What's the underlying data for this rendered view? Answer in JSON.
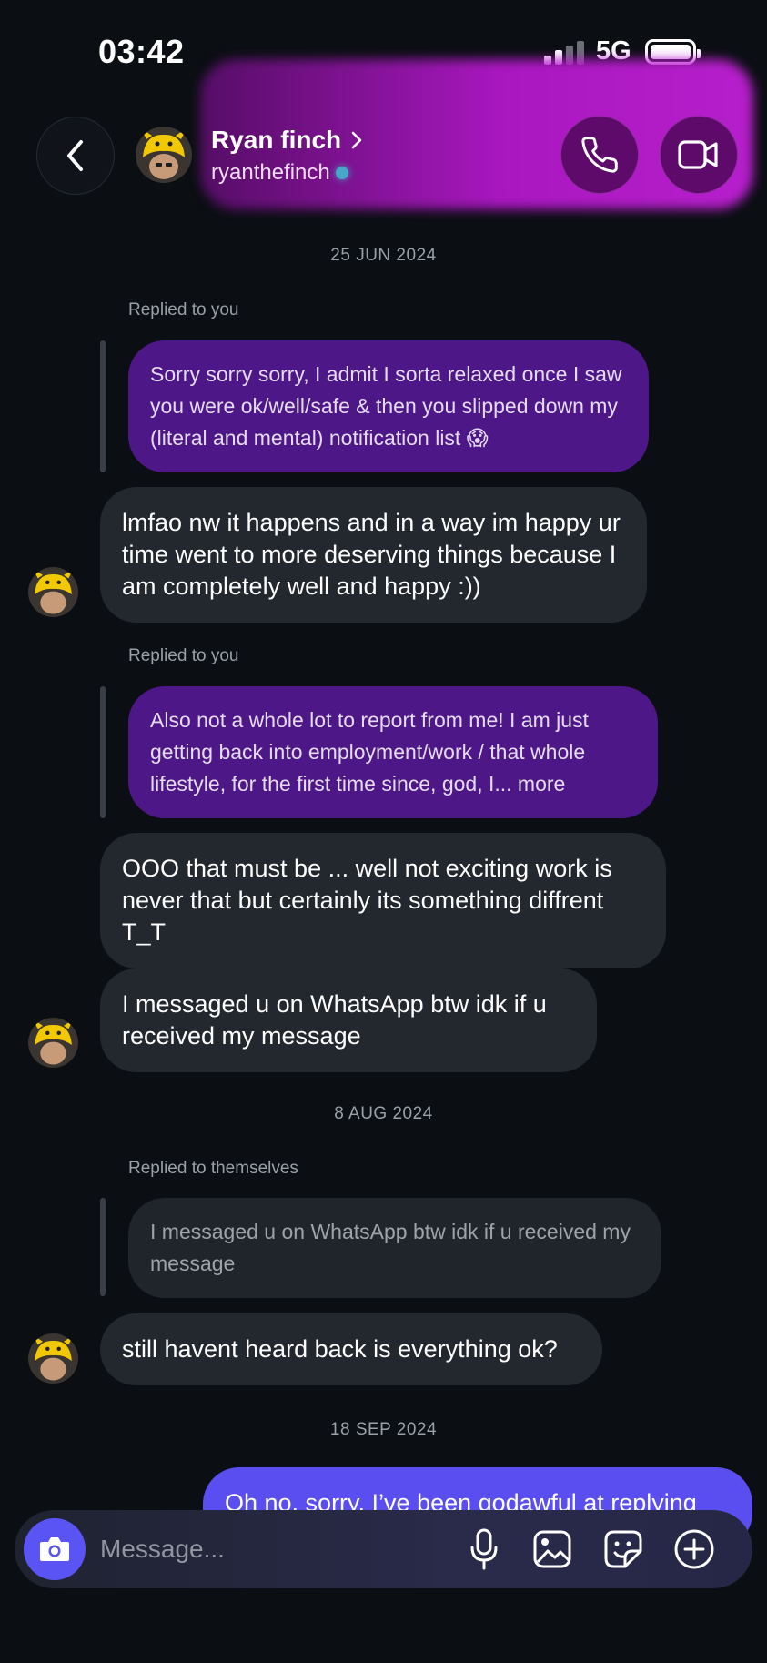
{
  "status_bar": {
    "time": "03:42",
    "network": "5G"
  },
  "header": {
    "contact_name": "Ryan finch",
    "handle": "ryanthefinch"
  },
  "icons": {
    "back": "chevron-left-icon",
    "call": "phone-icon",
    "video": "video-camera-icon",
    "camera": "camera-icon",
    "mic": "microphone-icon",
    "gallery": "image-icon",
    "sticker": "sticker-icon",
    "add": "plus-circle-icon"
  },
  "colors": {
    "accent": "#5b4ef0",
    "header_glow": "#b218c9",
    "quoted_bubble": "#4e1787",
    "incoming_bubble": "#23272e"
  },
  "conversation": {
    "date_1": "25 JUN 2024",
    "reply_label_1": "Replied to you",
    "quoted_1": "Sorry sorry sorry, I admit I sorta relaxed once I saw you were ok/well/safe & then you slipped down my (literal and mental) notification list 😱",
    "message_1": "lmfao nw it happens and in a way im happy ur time went to more deserving things because I am completely well  and happy :))",
    "reply_label_2": "Replied to you",
    "quoted_2": "Also not a whole lot to report from me! I am just getting back into employment/work / that whole lifestyle, for the first time since, god, I... more",
    "message_2": "OOO that must be ... well not exciting work is never that but certainly its something diffrent T_T",
    "message_3": "I messaged u on WhatsApp btw idk if u received my message",
    "date_2": "8 AUG 2024",
    "reply_label_3": "Replied to themselves",
    "quoted_3": "I messaged u on WhatsApp btw idk if u received my message",
    "message_4": "still havent heard back is everything ok?",
    "date_3": "18 SEP 2024",
    "message_5": "Oh no, sorry, I’ve been godawful at replying"
  },
  "composer": {
    "placeholder": "Message..."
  }
}
